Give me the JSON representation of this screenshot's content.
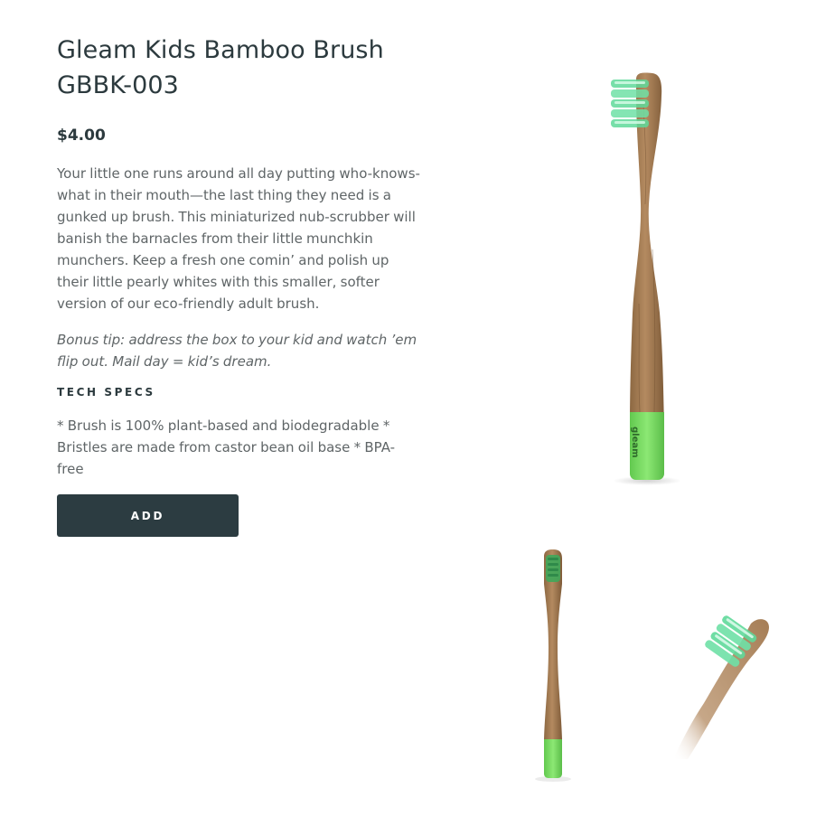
{
  "product": {
    "title_line1": "Gleam Kids Bamboo Brush",
    "title_line2": "GBBK-003",
    "price": "$4.00",
    "description": "Your little one runs around all day putting who-knows-what in their mouth—the last thing they need is a gunked up brush. This miniaturized nub-scrubber will banish the barnacles from their little munchkin munchers. Keep a fresh one comin’ and polish up their little pearly whites with this smaller, softer version of our eco-friendly adult brush.",
    "bonus_tip": "Bonus tip: address the box to your kid and watch ’em flip out. Mail day = kid’s dream.",
    "specs_heading": "TECH SPECS",
    "specs_text": "* Brush is 100% plant-based and biodegradable * Bristles are made from castor bean oil base * BPA-free",
    "add_label": "ADD"
  },
  "images": {
    "brand_mark": "gleam"
  },
  "colors": {
    "button_bg": "#2c3c41",
    "bamboo": "#a57d55",
    "bristle_green": "#5fd99a",
    "handle_tip_green": "#7fe06a"
  }
}
